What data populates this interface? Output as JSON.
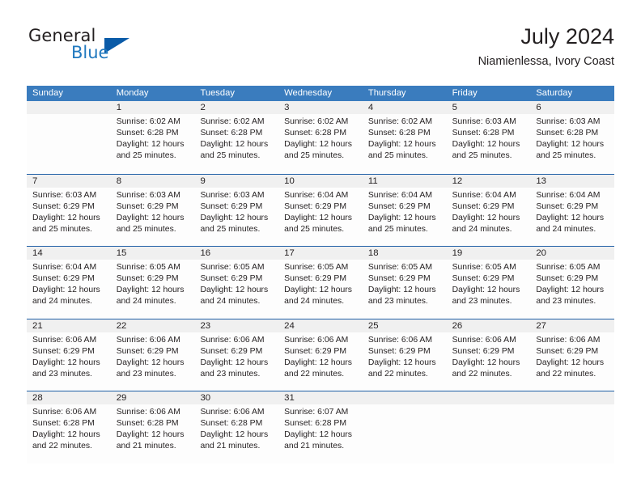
{
  "brand": {
    "name_part1": "General",
    "name_part2": "Blue",
    "triangle_color": "#0a5ba8",
    "blue_color": "#2179bf"
  },
  "header": {
    "month_title": "July 2024",
    "location": "Niamienlessa, Ivory Coast"
  },
  "theme": {
    "header_bg": "#3a7cbe",
    "header_text": "#ffffff",
    "row_divider": "#1f5fa6",
    "date_strip_bg": "#f0f0f0",
    "cell_bg": "#fdfdfd",
    "text": "#231f20"
  },
  "day_headers": [
    "Sunday",
    "Monday",
    "Tuesday",
    "Wednesday",
    "Thursday",
    "Friday",
    "Saturday"
  ],
  "weeks": [
    {
      "days": [
        {
          "date": "",
          "empty": true,
          "sunrise": "",
          "sunset": "",
          "daylight": ""
        },
        {
          "date": "1",
          "empty": false,
          "sunrise": "Sunrise: 6:02 AM",
          "sunset": "Sunset: 6:28 PM",
          "daylight": "Daylight: 12 hours and 25 minutes."
        },
        {
          "date": "2",
          "empty": false,
          "sunrise": "Sunrise: 6:02 AM",
          "sunset": "Sunset: 6:28 PM",
          "daylight": "Daylight: 12 hours and 25 minutes."
        },
        {
          "date": "3",
          "empty": false,
          "sunrise": "Sunrise: 6:02 AM",
          "sunset": "Sunset: 6:28 PM",
          "daylight": "Daylight: 12 hours and 25 minutes."
        },
        {
          "date": "4",
          "empty": false,
          "sunrise": "Sunrise: 6:02 AM",
          "sunset": "Sunset: 6:28 PM",
          "daylight": "Daylight: 12 hours and 25 minutes."
        },
        {
          "date": "5",
          "empty": false,
          "sunrise": "Sunrise: 6:03 AM",
          "sunset": "Sunset: 6:28 PM",
          "daylight": "Daylight: 12 hours and 25 minutes."
        },
        {
          "date": "6",
          "empty": false,
          "sunrise": "Sunrise: 6:03 AM",
          "sunset": "Sunset: 6:28 PM",
          "daylight": "Daylight: 12 hours and 25 minutes."
        }
      ]
    },
    {
      "days": [
        {
          "date": "7",
          "empty": false,
          "sunrise": "Sunrise: 6:03 AM",
          "sunset": "Sunset: 6:29 PM",
          "daylight": "Daylight: 12 hours and 25 minutes."
        },
        {
          "date": "8",
          "empty": false,
          "sunrise": "Sunrise: 6:03 AM",
          "sunset": "Sunset: 6:29 PM",
          "daylight": "Daylight: 12 hours and 25 minutes."
        },
        {
          "date": "9",
          "empty": false,
          "sunrise": "Sunrise: 6:03 AM",
          "sunset": "Sunset: 6:29 PM",
          "daylight": "Daylight: 12 hours and 25 minutes."
        },
        {
          "date": "10",
          "empty": false,
          "sunrise": "Sunrise: 6:04 AM",
          "sunset": "Sunset: 6:29 PM",
          "daylight": "Daylight: 12 hours and 25 minutes."
        },
        {
          "date": "11",
          "empty": false,
          "sunrise": "Sunrise: 6:04 AM",
          "sunset": "Sunset: 6:29 PM",
          "daylight": "Daylight: 12 hours and 25 minutes."
        },
        {
          "date": "12",
          "empty": false,
          "sunrise": "Sunrise: 6:04 AM",
          "sunset": "Sunset: 6:29 PM",
          "daylight": "Daylight: 12 hours and 24 minutes."
        },
        {
          "date": "13",
          "empty": false,
          "sunrise": "Sunrise: 6:04 AM",
          "sunset": "Sunset: 6:29 PM",
          "daylight": "Daylight: 12 hours and 24 minutes."
        }
      ]
    },
    {
      "days": [
        {
          "date": "14",
          "empty": false,
          "sunrise": "Sunrise: 6:04 AM",
          "sunset": "Sunset: 6:29 PM",
          "daylight": "Daylight: 12 hours and 24 minutes."
        },
        {
          "date": "15",
          "empty": false,
          "sunrise": "Sunrise: 6:05 AM",
          "sunset": "Sunset: 6:29 PM",
          "daylight": "Daylight: 12 hours and 24 minutes."
        },
        {
          "date": "16",
          "empty": false,
          "sunrise": "Sunrise: 6:05 AM",
          "sunset": "Sunset: 6:29 PM",
          "daylight": "Daylight: 12 hours and 24 minutes."
        },
        {
          "date": "17",
          "empty": false,
          "sunrise": "Sunrise: 6:05 AM",
          "sunset": "Sunset: 6:29 PM",
          "daylight": "Daylight: 12 hours and 24 minutes."
        },
        {
          "date": "18",
          "empty": false,
          "sunrise": "Sunrise: 6:05 AM",
          "sunset": "Sunset: 6:29 PM",
          "daylight": "Daylight: 12 hours and 23 minutes."
        },
        {
          "date": "19",
          "empty": false,
          "sunrise": "Sunrise: 6:05 AM",
          "sunset": "Sunset: 6:29 PM",
          "daylight": "Daylight: 12 hours and 23 minutes."
        },
        {
          "date": "20",
          "empty": false,
          "sunrise": "Sunrise: 6:05 AM",
          "sunset": "Sunset: 6:29 PM",
          "daylight": "Daylight: 12 hours and 23 minutes."
        }
      ]
    },
    {
      "days": [
        {
          "date": "21",
          "empty": false,
          "sunrise": "Sunrise: 6:06 AM",
          "sunset": "Sunset: 6:29 PM",
          "daylight": "Daylight: 12 hours and 23 minutes."
        },
        {
          "date": "22",
          "empty": false,
          "sunrise": "Sunrise: 6:06 AM",
          "sunset": "Sunset: 6:29 PM",
          "daylight": "Daylight: 12 hours and 23 minutes."
        },
        {
          "date": "23",
          "empty": false,
          "sunrise": "Sunrise: 6:06 AM",
          "sunset": "Sunset: 6:29 PM",
          "daylight": "Daylight: 12 hours and 23 minutes."
        },
        {
          "date": "24",
          "empty": false,
          "sunrise": "Sunrise: 6:06 AM",
          "sunset": "Sunset: 6:29 PM",
          "daylight": "Daylight: 12 hours and 22 minutes."
        },
        {
          "date": "25",
          "empty": false,
          "sunrise": "Sunrise: 6:06 AM",
          "sunset": "Sunset: 6:29 PM",
          "daylight": "Daylight: 12 hours and 22 minutes."
        },
        {
          "date": "26",
          "empty": false,
          "sunrise": "Sunrise: 6:06 AM",
          "sunset": "Sunset: 6:29 PM",
          "daylight": "Daylight: 12 hours and 22 minutes."
        },
        {
          "date": "27",
          "empty": false,
          "sunrise": "Sunrise: 6:06 AM",
          "sunset": "Sunset: 6:29 PM",
          "daylight": "Daylight: 12 hours and 22 minutes."
        }
      ]
    },
    {
      "days": [
        {
          "date": "28",
          "empty": false,
          "sunrise": "Sunrise: 6:06 AM",
          "sunset": "Sunset: 6:28 PM",
          "daylight": "Daylight: 12 hours and 22 minutes."
        },
        {
          "date": "29",
          "empty": false,
          "sunrise": "Sunrise: 6:06 AM",
          "sunset": "Sunset: 6:28 PM",
          "daylight": "Daylight: 12 hours and 21 minutes."
        },
        {
          "date": "30",
          "empty": false,
          "sunrise": "Sunrise: 6:06 AM",
          "sunset": "Sunset: 6:28 PM",
          "daylight": "Daylight: 12 hours and 21 minutes."
        },
        {
          "date": "31",
          "empty": false,
          "sunrise": "Sunrise: 6:07 AM",
          "sunset": "Sunset: 6:28 PM",
          "daylight": "Daylight: 12 hours and 21 minutes."
        },
        {
          "date": "",
          "empty": true,
          "sunrise": "",
          "sunset": "",
          "daylight": ""
        },
        {
          "date": "",
          "empty": true,
          "sunrise": "",
          "sunset": "",
          "daylight": ""
        },
        {
          "date": "",
          "empty": true,
          "sunrise": "",
          "sunset": "",
          "daylight": ""
        }
      ]
    }
  ]
}
